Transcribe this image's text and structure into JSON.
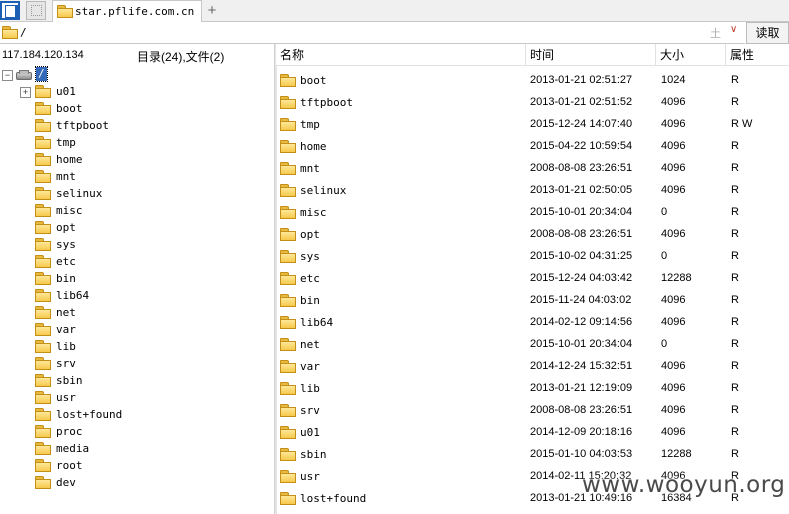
{
  "tabbar": {
    "tab_title": "star.pflife.com.cn",
    "add_label": "+"
  },
  "pathbar": {
    "path": "/",
    "up_label": "土",
    "dropdown_label": "∨",
    "read_label": "读取"
  },
  "left": {
    "ip": "117.184.120.134",
    "counts": "目录(24),文件(2)"
  },
  "tree": {
    "root_expander": "−",
    "root_label": "/",
    "items": [
      {
        "label": "u01",
        "expander": "+"
      },
      {
        "label": "boot"
      },
      {
        "label": "tftpboot"
      },
      {
        "label": "tmp"
      },
      {
        "label": "home"
      },
      {
        "label": "mnt"
      },
      {
        "label": "selinux"
      },
      {
        "label": "misc"
      },
      {
        "label": "opt"
      },
      {
        "label": "sys"
      },
      {
        "label": "etc"
      },
      {
        "label": "bin"
      },
      {
        "label": "lib64"
      },
      {
        "label": "net"
      },
      {
        "label": "var"
      },
      {
        "label": "lib"
      },
      {
        "label": "srv"
      },
      {
        "label": "sbin"
      },
      {
        "label": "usr"
      },
      {
        "label": "lost+found"
      },
      {
        "label": "proc"
      },
      {
        "label": "media"
      },
      {
        "label": "root"
      },
      {
        "label": "dev"
      }
    ]
  },
  "list": {
    "columns": {
      "name": "名称",
      "time": "时间",
      "size": "大小",
      "attr": "属性"
    },
    "rows": [
      {
        "name": "boot",
        "time": "2013-01-21 02:51:27",
        "size": "1024",
        "attr": "R"
      },
      {
        "name": "tftpboot",
        "time": "2013-01-21 02:51:52",
        "size": "4096",
        "attr": "R"
      },
      {
        "name": "tmp",
        "time": "2015-12-24 14:07:40",
        "size": "4096",
        "attr": "R W"
      },
      {
        "name": "home",
        "time": "2015-04-22 10:59:54",
        "size": "4096",
        "attr": "R"
      },
      {
        "name": "mnt",
        "time": "2008-08-08 23:26:51",
        "size": "4096",
        "attr": "R"
      },
      {
        "name": "selinux",
        "time": "2013-01-21 02:50:05",
        "size": "4096",
        "attr": "R"
      },
      {
        "name": "misc",
        "time": "2015-10-01 20:34:04",
        "size": "0",
        "attr": "R"
      },
      {
        "name": "opt",
        "time": "2008-08-08 23:26:51",
        "size": "4096",
        "attr": "R"
      },
      {
        "name": "sys",
        "time": "2015-10-02 04:31:25",
        "size": "0",
        "attr": "R"
      },
      {
        "name": "etc",
        "time": "2015-12-24 04:03:42",
        "size": "12288",
        "attr": "R"
      },
      {
        "name": "bin",
        "time": "2015-11-24 04:03:02",
        "size": "4096",
        "attr": "R"
      },
      {
        "name": "lib64",
        "time": "2014-02-12 09:14:56",
        "size": "4096",
        "attr": "R"
      },
      {
        "name": "net",
        "time": "2015-10-01 20:34:04",
        "size": "0",
        "attr": "R"
      },
      {
        "name": "var",
        "time": "2014-12-24 15:32:51",
        "size": "4096",
        "attr": "R"
      },
      {
        "name": "lib",
        "time": "2013-01-21 12:19:09",
        "size": "4096",
        "attr": "R"
      },
      {
        "name": "srv",
        "time": "2008-08-08 23:26:51",
        "size": "4096",
        "attr": "R"
      },
      {
        "name": "u01",
        "time": "2014-12-09 20:18:16",
        "size": "4096",
        "attr": "R"
      },
      {
        "name": "sbin",
        "time": "2015-01-10 04:03:53",
        "size": "12288",
        "attr": "R"
      },
      {
        "name": "usr",
        "time": "2014-02-11 15:20:32",
        "size": "4096",
        "attr": "R"
      },
      {
        "name": "lost+found",
        "time": "2013-01-21 10:49:16",
        "size": "16384",
        "attr": "R"
      }
    ]
  },
  "watermark": "www.wooyun.org"
}
